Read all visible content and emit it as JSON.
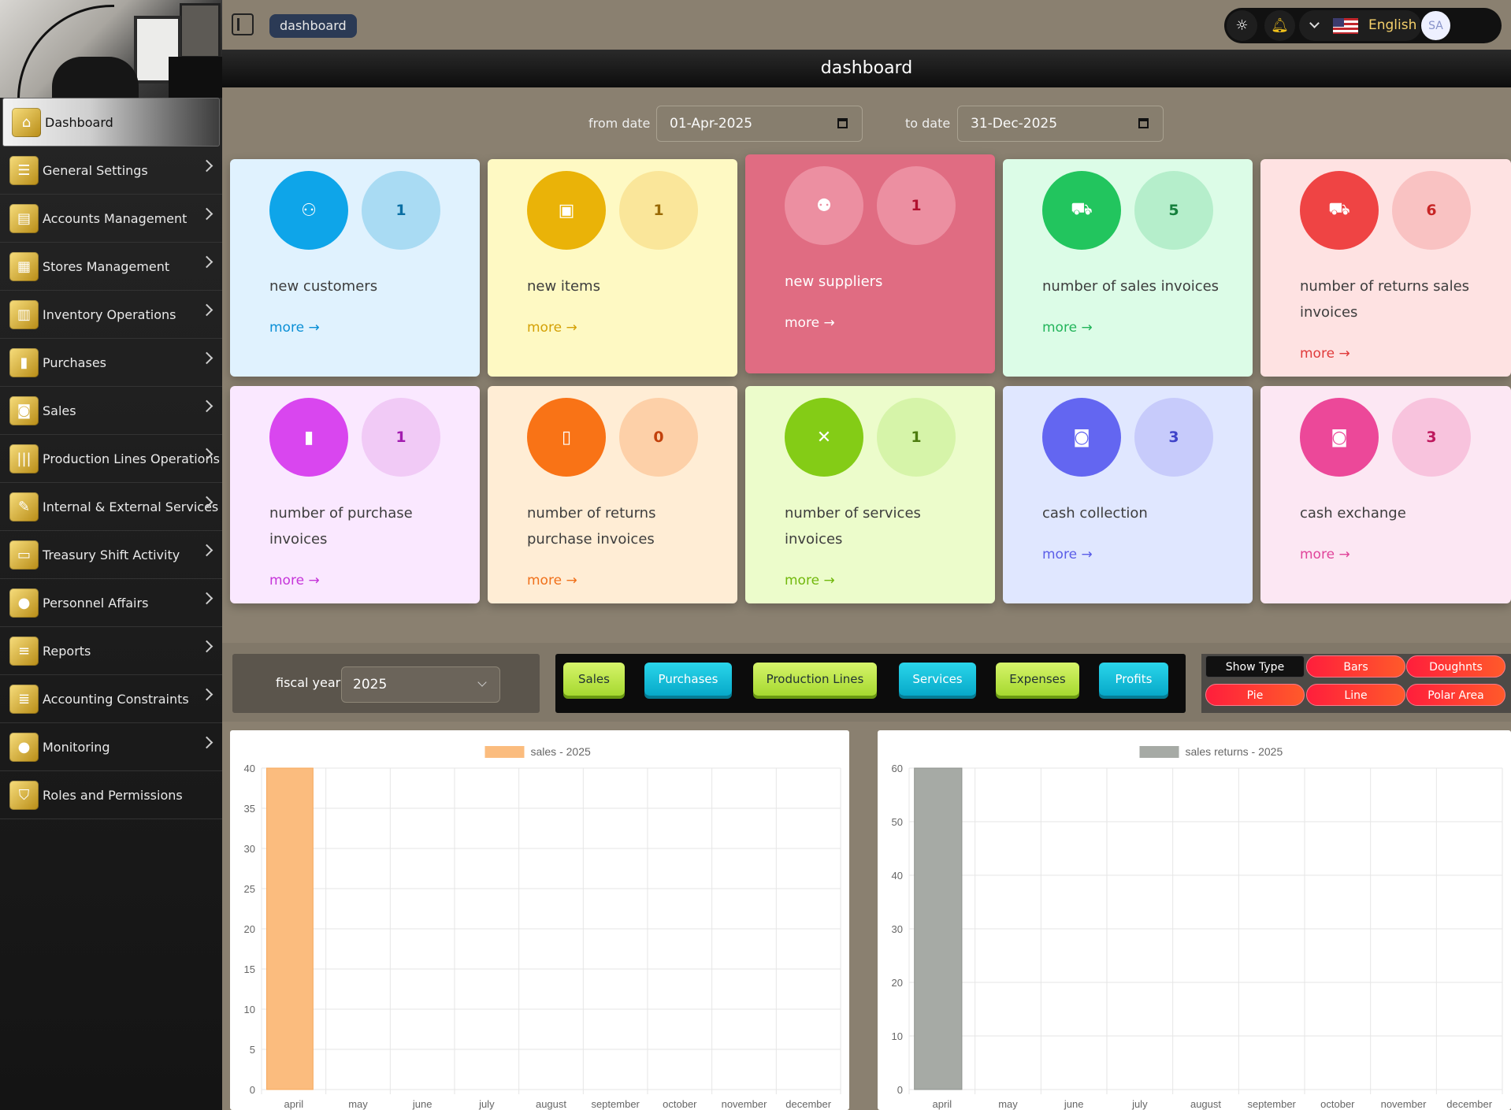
{
  "sidebar": {
    "items": [
      {
        "label": "Dashboard",
        "icon": "home-icon",
        "glyph": "⌂",
        "chevron": false
      },
      {
        "label": "General Settings",
        "icon": "sliders-icon",
        "glyph": "☰",
        "chevron": true
      },
      {
        "label": "Accounts Management",
        "icon": "folder-icon",
        "glyph": "▤",
        "chevron": true
      },
      {
        "label": "Stores Management",
        "icon": "store-icon",
        "glyph": "▦",
        "chevron": true
      },
      {
        "label": "Inventory Operations",
        "icon": "inventory-icon",
        "glyph": "▥",
        "chevron": true
      },
      {
        "label": "Purchases",
        "icon": "bag-icon",
        "glyph": "▮",
        "chevron": true
      },
      {
        "label": "Sales",
        "icon": "cart-icon",
        "glyph": "◙",
        "chevron": true
      },
      {
        "label": "Production Lines Operations",
        "icon": "bars-icon",
        "glyph": "|||",
        "chevron": true
      },
      {
        "label": "Internal & External Services",
        "icon": "tools-icon",
        "glyph": "✎",
        "chevron": true
      },
      {
        "label": "Treasury Shift Activity",
        "icon": "card-icon",
        "glyph": "▭",
        "chevron": true
      },
      {
        "label": "Personnel Affairs",
        "icon": "people-icon",
        "glyph": "●",
        "chevron": true
      },
      {
        "label": "Reports",
        "icon": "report-icon",
        "glyph": "≡",
        "chevron": true
      },
      {
        "label": "Accounting Constraints",
        "icon": "list-icon",
        "glyph": "≣",
        "chevron": true
      },
      {
        "label": "Monitoring",
        "icon": "monitor-icon",
        "glyph": "●",
        "chevron": true
      },
      {
        "label": "Roles and Permissions",
        "icon": "shield-icon",
        "glyph": "⛉",
        "chevron": false
      }
    ]
  },
  "topbar": {
    "breadcrumb": "dashboard",
    "language": "English",
    "avatar_initials": "SA"
  },
  "page_title": "dashboard",
  "filters": {
    "from_label": "from date",
    "from_value": "01-Apr-2025",
    "to_label": "to date",
    "to_value": "31-Dec-2025"
  },
  "cards": [
    {
      "label": "new customers",
      "count": "1",
      "more": "more →",
      "icon": "user-plus-icon",
      "glyph": "⚇",
      "iconColor": "#0ea5e9",
      "countBg": "#a9dbf3",
      "countColor": "#0a6fa3",
      "bg": "#e0f2fe",
      "moreColor": "#0a8fd6"
    },
    {
      "label": "new items",
      "count": "1",
      "more": "more →",
      "icon": "clipboard-check-icon",
      "glyph": "▣",
      "iconColor": "#eab308",
      "countBg": "#fae69a",
      "countColor": "#9a6a05",
      "bg": "#fef9c3",
      "moreColor": "#d4a106"
    },
    {
      "label": "new suppliers",
      "count": "1",
      "more": "more →",
      "icon": "users-icon",
      "glyph": "⚉",
      "iconColor": "#ec8fa1",
      "countBg": "#ec8fa1",
      "countColor": "#b0102e",
      "bg": "#e06c82",
      "moreColor": "#ffffff",
      "labelColor": "#ffffff"
    },
    {
      "label": "number of sales invoices",
      "count": "5",
      "more": "more →",
      "icon": "cart-icon",
      "glyph": "⛟",
      "iconColor": "#22c55e",
      "countBg": "#b5eecb",
      "countColor": "#15803d",
      "bg": "#dcfce7",
      "moreColor": "#22b45a"
    },
    {
      "label": "number of returns sales invoices",
      "count": "6",
      "more": "more →",
      "icon": "cart-return-icon",
      "glyph": "⛟",
      "iconColor": "#ef4444",
      "countBg": "#f9c2c2",
      "countColor": "#c72525",
      "bg": "#fee2e2",
      "moreColor": "#e03a3a"
    },
    {
      "label": "number of purchase invoices",
      "count": "1",
      "more": "more →",
      "icon": "bag-icon",
      "glyph": "▮",
      "iconColor": "#d946ef",
      "countBg": "#f1caf6",
      "countColor": "#a21caf",
      "bg": "#fae8ff",
      "moreColor": "#c535d9"
    },
    {
      "label": "number of returns purchase invoices",
      "count": "0",
      "more": "more →",
      "icon": "bag-return-icon",
      "glyph": "▯",
      "iconColor": "#f97316",
      "countBg": "#fdd0a8",
      "countColor": "#c2410c",
      "bg": "#ffedd5",
      "moreColor": "#f0701a"
    },
    {
      "label": "number of services invoices",
      "count": "1",
      "more": "more →",
      "icon": "tools-icon",
      "glyph": "✕",
      "iconColor": "#84cc16",
      "countBg": "#d6f4a9",
      "countColor": "#4d7c0f",
      "bg": "#ecfccb",
      "moreColor": "#72b80d"
    },
    {
      "label": "cash collection",
      "count": "3",
      "more": "more →",
      "icon": "money-icon",
      "glyph": "◙",
      "iconColor": "#6366f1",
      "countBg": "#c7cbfb",
      "countColor": "#3f43c9",
      "bg": "#e0e7ff",
      "moreColor": "#5a5de8"
    },
    {
      "label": "cash exchange",
      "count": "3",
      "more": "more →",
      "icon": "money-icon",
      "glyph": "◙",
      "iconColor": "#ec4899",
      "countBg": "#f8c3dd",
      "countColor": "#be185d",
      "bg": "#fce7f3",
      "moreColor": "#e0449a"
    }
  ],
  "controls": {
    "fiscal_label": "fiscal year",
    "fiscal_value": "2025",
    "datasets": [
      "Sales",
      "Purchases",
      "Production Lines",
      "Services",
      "Expenses",
      "Profits"
    ],
    "show_type_label": "Show Type",
    "types": [
      "Bars",
      "Doughnts",
      "Pie",
      "Line",
      "Polar Area"
    ]
  },
  "colors": {
    "sales_bar": "#fbbc7e",
    "returns_bar": "#a6aaa5"
  },
  "chart_data": [
    {
      "type": "bar",
      "title": "",
      "legend": "sales  -  2025",
      "categories": [
        "april",
        "may",
        "june",
        "july",
        "august",
        "september",
        "october",
        "november",
        "december"
      ],
      "series": [
        {
          "name": "sales  -  2025",
          "values": [
            40,
            0,
            0,
            0,
            0,
            0,
            0,
            0,
            0
          ]
        }
      ],
      "ylim": [
        0,
        40
      ],
      "yticks": [
        0,
        5,
        10,
        15,
        20,
        25,
        30,
        35,
        40
      ],
      "grid": true,
      "legend_position": "top"
    },
    {
      "type": "bar",
      "title": "",
      "legend": "sales returns  -  2025",
      "categories": [
        "april",
        "may",
        "june",
        "july",
        "august",
        "september",
        "october",
        "november",
        "december"
      ],
      "series": [
        {
          "name": "sales returns  -  2025",
          "values": [
            60,
            0,
            0,
            0,
            0,
            0,
            0,
            0,
            0
          ]
        }
      ],
      "ylim": [
        0,
        60
      ],
      "yticks": [
        0,
        10,
        20,
        30,
        40,
        50,
        60
      ],
      "grid": true,
      "legend_position": "top"
    }
  ]
}
